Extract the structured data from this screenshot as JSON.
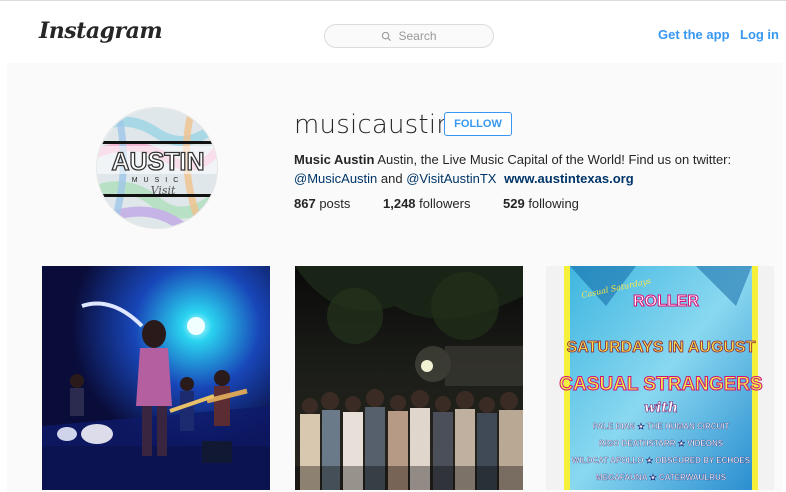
{
  "nav": {
    "logo": "Instagram",
    "search_placeholder": "Search",
    "get_app": "Get the app",
    "login": "Log in"
  },
  "profile": {
    "avatar_text": "AUSTIN",
    "avatar_subtext": "MUSIC",
    "avatar_script": "Visit",
    "username": "musicaustin",
    "follow_label": "FOLLOW",
    "full_name": "Music Austin",
    "bio_text_1": " Austin, the Live Music Capital of the World! Find us on twitter:",
    "handle_1": "@MusicAustin",
    "bio_and": " and ",
    "handle_2": "@VisitAustinTX",
    "website": "www.austintexas.org",
    "stats": {
      "posts_count": "867",
      "posts_label": " posts",
      "followers_count": "1,248",
      "followers_label": " followers",
      "following_count": "529",
      "following_label": " following"
    }
  },
  "posts": {
    "poster_script_title": "Casual Saturdays",
    "poster_top_logo": "ROLLER",
    "poster_headline": "SATURDAYS IN AUGUST",
    "poster_band": "CASUAL STRANGERS",
    "poster_with": "with",
    "poster_lines": [
      "PALE DIAN ★ THE HUMAN CIRCUIT",
      "RIGO DEATHSTARR ★ VIDEONS",
      "WILDCAT APOLLO ★ OBSCURED BY ECHOES",
      "MEGAFAUNA ★ CATERWAULRUS"
    ]
  },
  "colors": {
    "link_blue": "#3897f0",
    "dark_link": "#003569",
    "page_bg": "#fafafa",
    "text": "#262626"
  }
}
